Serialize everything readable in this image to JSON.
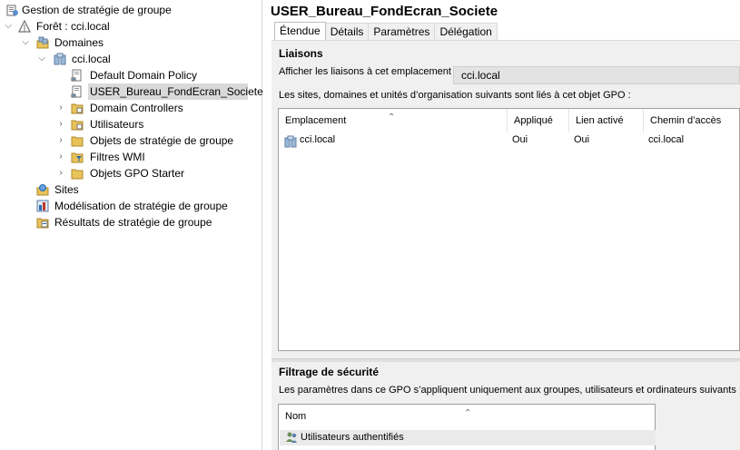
{
  "tree": {
    "root": "Gestion de stratégie de groupe",
    "forest": "Forêt : cci.local",
    "domains": "Domaines",
    "domain": "cci.local",
    "children": [
      "Default Domain Policy",
      "USER_Bureau_FondEcran_Societe",
      "Domain Controllers",
      "Utilisateurs",
      "Objets de stratégie de groupe",
      "Filtres WMI",
      "Objets GPO Starter"
    ],
    "sites": "Sites",
    "modeling": "Modélisation de stratégie de groupe",
    "results": "Résultats de stratégie de groupe"
  },
  "gpo": {
    "title": "USER_Bureau_FondEcran_Societe",
    "tabs": [
      "Étendue",
      "Détails",
      "Paramètres",
      "Délégation"
    ],
    "active_tab": "Étendue"
  },
  "links": {
    "heading": "Liaisons",
    "location_label": "Afficher les liaisons à cet emplacement :",
    "location_value": "cci.local",
    "description": "Les sites, domaines et unités d’organisation suivants sont liés à cet objet GPO :",
    "columns": [
      "Emplacement",
      "Appliqué",
      "Lien activé",
      "Chemin d’accès"
    ],
    "rows": [
      {
        "location": "cci.local",
        "enforced": "Oui",
        "enabled": "Oui",
        "path": "cci.local"
      }
    ]
  },
  "security": {
    "heading": "Filtrage de sécurité",
    "description": "Les paramètres dans ce GPO s’appliquent uniquement aux groupes, utilisateurs et ordinateurs suivants :",
    "column": "Nom",
    "rows": [
      "Utilisateurs authentifiés"
    ]
  },
  "colors": {
    "selection": "#d9d9d9",
    "panel": "#f0f0f0",
    "field": "#e3e3e3",
    "folder": "#e8c35a"
  },
  "icons": [
    "gpm-icon",
    "forest-icon",
    "domains-icon",
    "domain-icon",
    "gpo-link-icon",
    "folder-icon",
    "ou-icon",
    "wmi-filter-icon",
    "sites-icon",
    "modeling-icon",
    "results-icon",
    "users-group-icon"
  ]
}
